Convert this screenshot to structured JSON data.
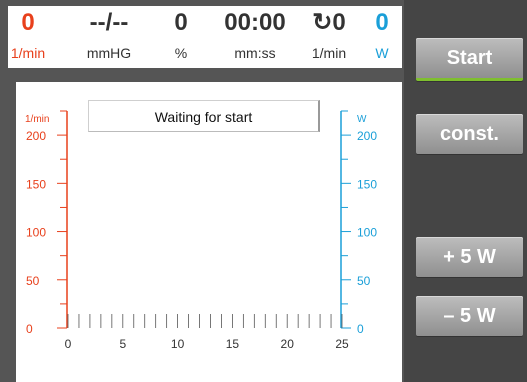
{
  "status": [
    {
      "value": "0",
      "unit": "1/min",
      "color": "#e8401c"
    },
    {
      "value": "--/--",
      "unit": "mmHG",
      "color": "#333333"
    },
    {
      "value": "0",
      "unit": "%",
      "color": "#333333"
    },
    {
      "value": "00:00",
      "unit": "mm:ss",
      "color": "#333333"
    },
    {
      "value": "↻0",
      "unit": "1/min",
      "color": "#333333"
    },
    {
      "value": "0",
      "unit": "W",
      "color": "#1a9fd8"
    }
  ],
  "message": "Waiting for start",
  "buttons": {
    "start": "Start",
    "const": "const.",
    "plus": "+ 5 W",
    "minus": "– 5 W"
  },
  "chart_data": {
    "type": "line",
    "left_axis": {
      "label": "1/min",
      "ticks": [
        "0",
        "50",
        "100",
        "150",
        "200"
      ],
      "range": [
        0,
        225
      ],
      "color": "#e8401c"
    },
    "right_axis": {
      "label": "W",
      "ticks": [
        "0",
        "50",
        "100",
        "150",
        "200"
      ],
      "range": [
        0,
        225
      ],
      "color": "#1a9fd8"
    },
    "x_axis": {
      "ticks": [
        "0",
        "5",
        "10",
        "15",
        "20",
        "25"
      ],
      "range": [
        0,
        25
      ]
    },
    "series": []
  }
}
